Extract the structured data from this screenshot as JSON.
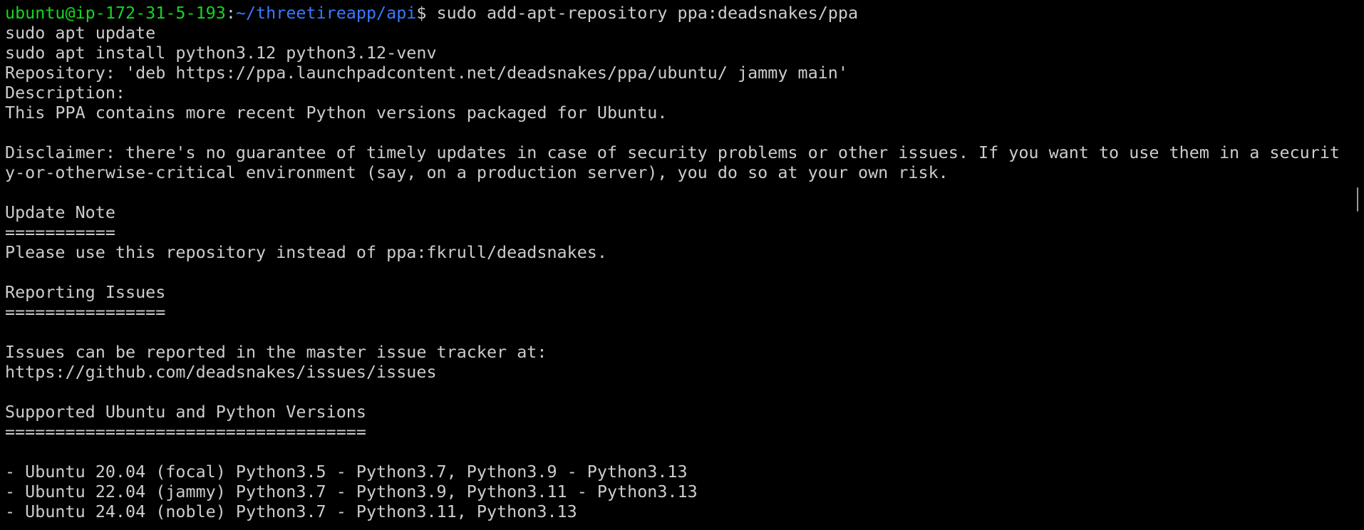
{
  "prompt": {
    "user_host": "ubuntu@ip-172-31-5-193",
    "separator": ":",
    "path": "~/threetireapp/api",
    "symbol": "$ ",
    "command": "sudo add-apt-repository ppa:deadsnakes/ppa"
  },
  "lines": [
    "sudo apt update",
    "sudo apt install python3.12 python3.12-venv",
    "Repository: 'deb https://ppa.launchpadcontent.net/deadsnakes/ppa/ubuntu/ jammy main'",
    "Description:",
    "This PPA contains more recent Python versions packaged for Ubuntu.",
    "",
    "Disclaimer: there's no guarantee of timely updates in case of security problems or other issues. If you want to use them in a securit",
    "y-or-otherwise-critical environment (say, on a production server), you do so at your own risk.",
    "",
    "Update Note",
    "===========",
    "Please use this repository instead of ppa:fkrull/deadsnakes.",
    "",
    "Reporting Issues",
    "================",
    "",
    "Issues can be reported in the master issue tracker at:",
    "https://github.com/deadsnakes/issues/issues",
    "",
    "Supported Ubuntu and Python Versions",
    "====================================",
    "",
    "- Ubuntu 20.04 (focal) Python3.5 - Python3.7, Python3.9 - Python3.13",
    "- Ubuntu 22.04 (jammy) Python3.7 - Python3.9, Python3.11 - Python3.13",
    "- Ubuntu 24.04 (noble) Python3.7 - Python3.11, Python3.13"
  ]
}
